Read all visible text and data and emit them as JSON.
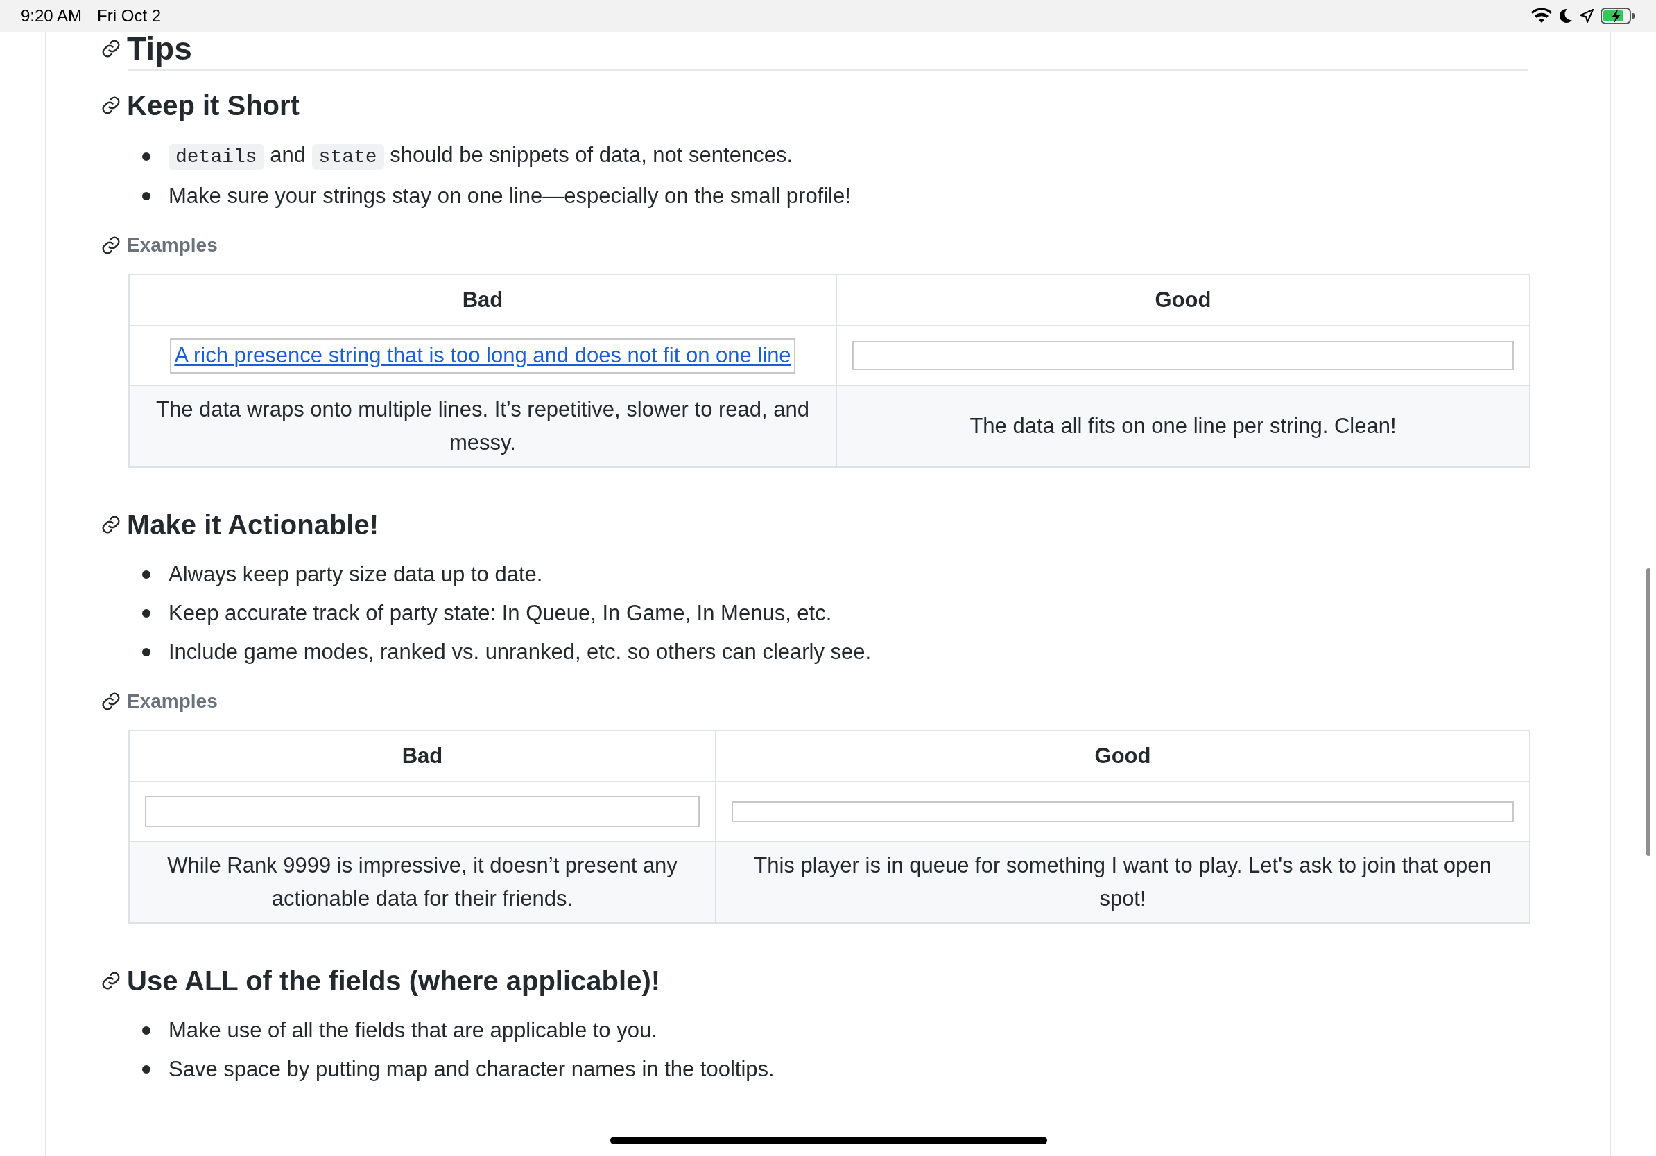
{
  "status_bar": {
    "time": "9:20 AM",
    "date": "Fri Oct 2",
    "battery": {
      "charging": true,
      "level": 0.8
    }
  },
  "page_title": "Tips",
  "sections": [
    {
      "title": "Keep it Short",
      "bullets": [
        [
          {
            "kind": "code",
            "text": "details"
          },
          {
            "kind": "plain",
            "text": " and "
          },
          {
            "kind": "code",
            "text": "state"
          },
          {
            "kind": "plain",
            "text": " should be snippets of data, not sentences."
          }
        ],
        [
          {
            "kind": "plain",
            "text": "Make sure your strings stay on one line—especially on the small profile!"
          }
        ]
      ],
      "examples": {
        "title": "Examples",
        "headers": [
          "Bad",
          "Good"
        ],
        "images": [
          {
            "kind": "alt_link",
            "text": "A rich presence string that is too long and does not fit on one line"
          },
          {
            "kind": "empty"
          }
        ],
        "captions": [
          "The data wraps onto multiple lines. It’s repetitive, slower to read, and messy.",
          "The data all fits on one line per string. Clean!"
        ]
      }
    },
    {
      "title": "Make it Actionable!",
      "bullets": [
        [
          {
            "kind": "plain",
            "text": "Always keep party size data up to date."
          }
        ],
        [
          {
            "kind": "plain",
            "text": "Keep accurate track of party state: In Queue, In Game, In Menus, etc."
          }
        ],
        [
          {
            "kind": "plain",
            "text": "Include game modes, ranked vs. unranked, etc. so others can clearly see."
          }
        ]
      ],
      "examples": {
        "title": "Examples",
        "headers": [
          "Bad",
          "Good"
        ],
        "images": [
          {
            "kind": "empty"
          },
          {
            "kind": "empty"
          }
        ],
        "captions": [
          "While Rank 9999 is impressive, it doesn’t present any actionable data for their friends.",
          "This player is in queue for something I want to play. Let's ask to join that open spot!"
        ]
      }
    },
    {
      "title": "Use ALL of the fields (where applicable)!",
      "bullets": [
        [
          {
            "kind": "plain",
            "text": "Make use of all the fields that are applicable to you."
          }
        ],
        [
          {
            "kind": "plain",
            "text": "Save space by putting map and character names in the tooltips."
          }
        ]
      ]
    }
  ]
}
